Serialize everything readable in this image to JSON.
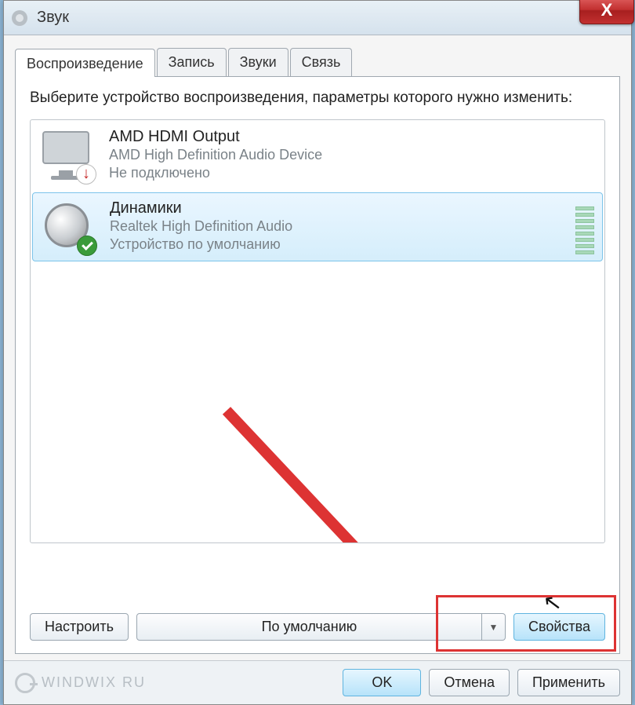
{
  "window": {
    "title": "Звук",
    "close_symbol": "X"
  },
  "tabs": [
    {
      "label": "Воспроизведение",
      "active": true
    },
    {
      "label": "Запись",
      "active": false
    },
    {
      "label": "Звуки",
      "active": false
    },
    {
      "label": "Связь",
      "active": false
    }
  ],
  "instructions": "Выберите устройство воспроизведения, параметры которого нужно изменить:",
  "devices": [
    {
      "name": "AMD HDMI Output",
      "driver": "AMD High Definition Audio Device",
      "status": "Не подключено",
      "selected": false,
      "icon": "monitor",
      "badge": "disconnected"
    },
    {
      "name": "Динамики",
      "driver": "Realtek High Definition Audio",
      "status": "Устройство по умолчанию",
      "selected": true,
      "icon": "speaker",
      "badge": "default"
    }
  ],
  "buttons": {
    "configure": "Настроить",
    "set_default": "По умолчанию",
    "properties": "Свойства",
    "ok": "OK",
    "cancel": "Отмена",
    "apply": "Применить"
  },
  "watermark": "WINDWIX RU"
}
